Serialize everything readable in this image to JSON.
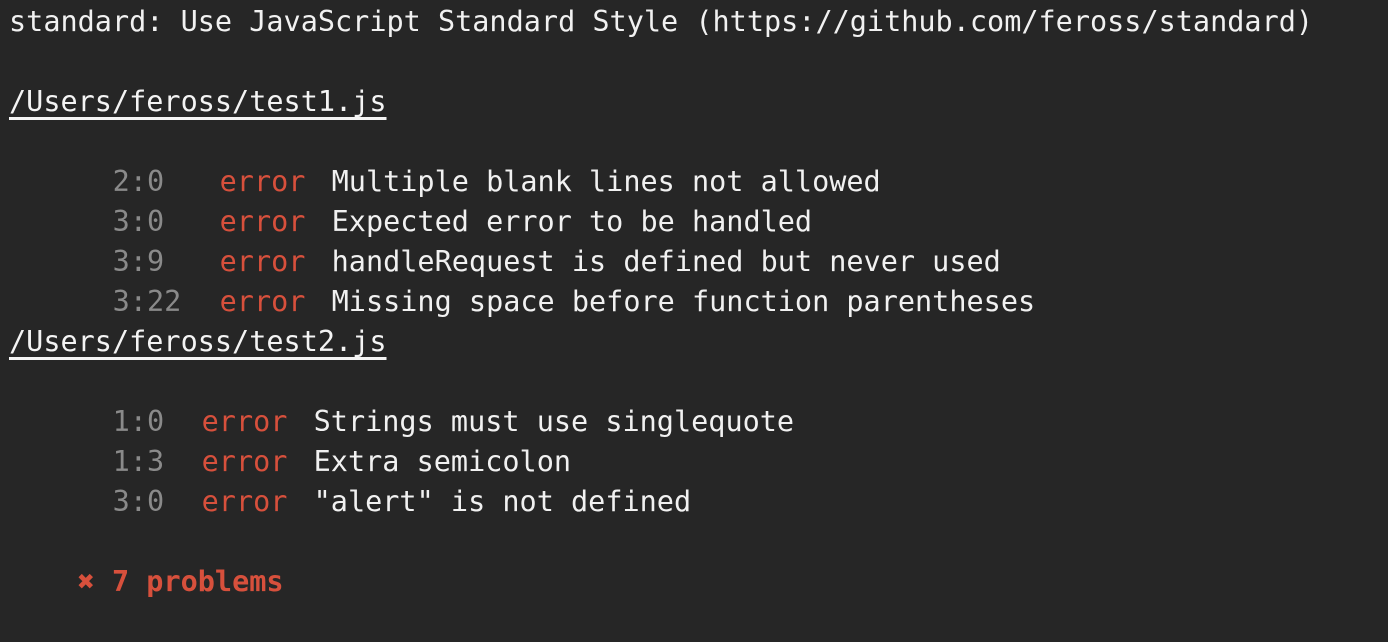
{
  "header": "standard: Use JavaScript Standard Style (https://github.com/feross/standard)",
  "colors": {
    "background": "#262626",
    "text": "#f1f1f1",
    "position": "#8a8a8a",
    "error": "#d7503c"
  },
  "files": [
    {
      "path": "/Users/feross/test1.js",
      "problems": [
        {
          "position": "2:0",
          "severity": "error",
          "message": "Multiple blank lines not allowed"
        },
        {
          "position": "3:0",
          "severity": "error",
          "message": "Expected error to be handled"
        },
        {
          "position": "3:9",
          "severity": "error",
          "message": "handleRequest is defined but never used"
        },
        {
          "position": "3:22",
          "severity": "error",
          "message": "Missing space before function parentheses"
        }
      ]
    },
    {
      "path": "/Users/feross/test2.js",
      "problems": [
        {
          "position": "1:0",
          "severity": "error",
          "message": "Strings must use singlequote"
        },
        {
          "position": "1:3",
          "severity": "error",
          "message": "Extra semicolon"
        },
        {
          "position": "3:0",
          "severity": "error",
          "message": "\"alert\" is not defined"
        }
      ]
    }
  ],
  "summary": {
    "icon": "x-icon",
    "icon_glyph": "✖",
    "text": "7 problems"
  }
}
